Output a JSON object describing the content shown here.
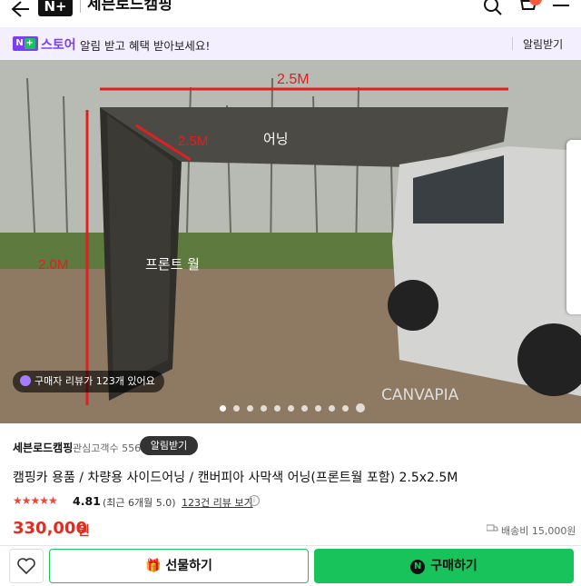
{
  "header": {
    "logo_text": "N+",
    "store_name": "세븐로드캠핑"
  },
  "banner": {
    "badge_n": "N",
    "badge_plus": "+",
    "store_label": "스토어",
    "message": "알림 받고 혜택 받아보세요!",
    "subscribe_label": "알림받기"
  },
  "hero": {
    "label_width": "2.5M",
    "label_depth": "2.5M",
    "label_height": "2.0M",
    "label_awning": "어닝",
    "label_wall": "프론트 월",
    "watermark": "CANVAPIA",
    "review_notice": "구매자 리뷰가 123개 있어요",
    "slide_count": 10
  },
  "product": {
    "seller": "세븐로드캠핑",
    "followers": "관심고객수 556",
    "alarm_label": "알림받기",
    "title": "캠핑카 용품 / 차량용 사이드어닝 / 캔버피아 사막색 어닝(프론트월 포함) 2.5x2.5M",
    "stars": "★★★★★",
    "rating": "4.81",
    "recent_rating": "(최근 6개월 5.0)",
    "review_link": "123건 리뷰 보기",
    "info_symbol": "i",
    "price": "330,000",
    "price_unit": "원",
    "shipping": "배송비 15,000원"
  },
  "actions": {
    "gift_label": "선물하기",
    "buy_label": "구매하기",
    "buy_icon": "N"
  },
  "colors": {
    "accent_green": "#19c35b",
    "store_purple": "#7b3ff2",
    "price_red": "#e52b1f",
    "star_red": "#e9473b"
  }
}
